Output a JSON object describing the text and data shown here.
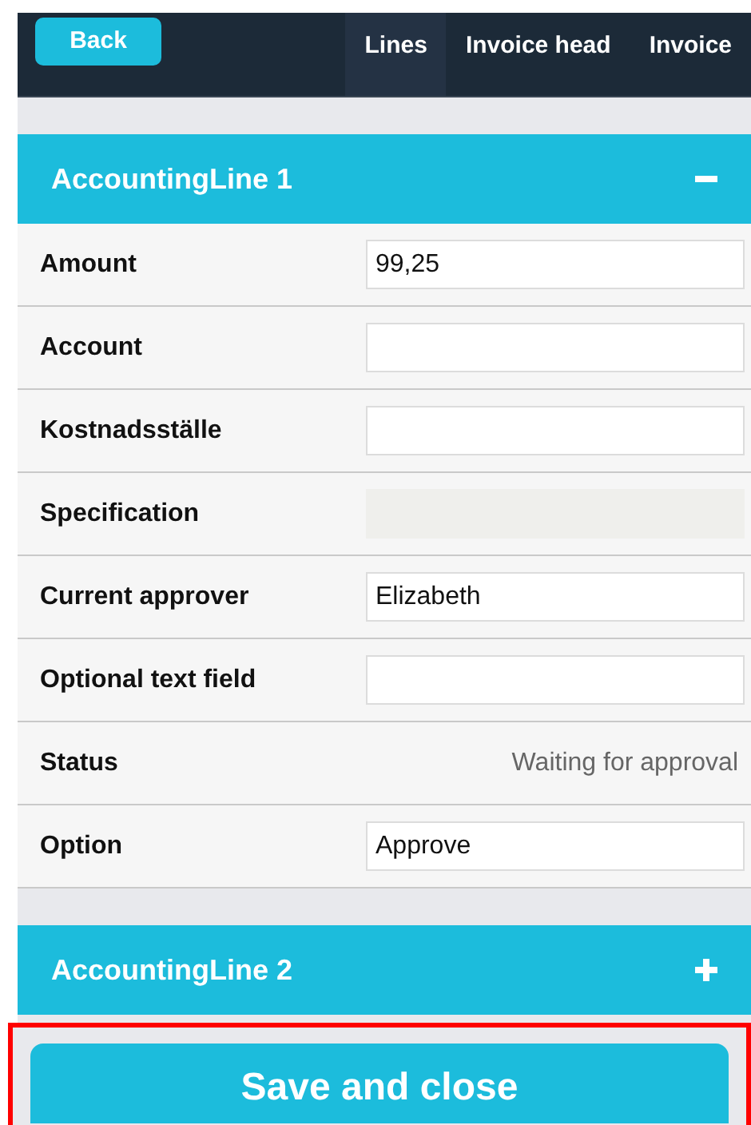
{
  "header": {
    "back_button": "Back",
    "tabs": [
      {
        "label": "Lines",
        "selected": true
      },
      {
        "label": "Invoice head",
        "selected": false
      },
      {
        "label": "Invoice",
        "selected": false
      }
    ]
  },
  "sections": [
    {
      "title": "AccountingLine 1",
      "expanded": true,
      "rows": [
        {
          "label": "Amount",
          "kind": "input",
          "value": "99,25"
        },
        {
          "label": "Account",
          "kind": "input"
        },
        {
          "label": "Kostnadsställe",
          "kind": "input"
        },
        {
          "label": "Specification",
          "kind": "disabled"
        },
        {
          "label": "Current approver",
          "kind": "input",
          "value": "Elizabeth"
        },
        {
          "label": "Optional text field",
          "kind": "input"
        },
        {
          "label": "Status",
          "kind": "text",
          "value": "Waiting for approval"
        },
        {
          "label": "Option",
          "kind": "input",
          "value": "Approve"
        }
      ]
    },
    {
      "title": "AccountingLine 2",
      "expanded": false
    }
  ],
  "save_button": "Save and close"
}
